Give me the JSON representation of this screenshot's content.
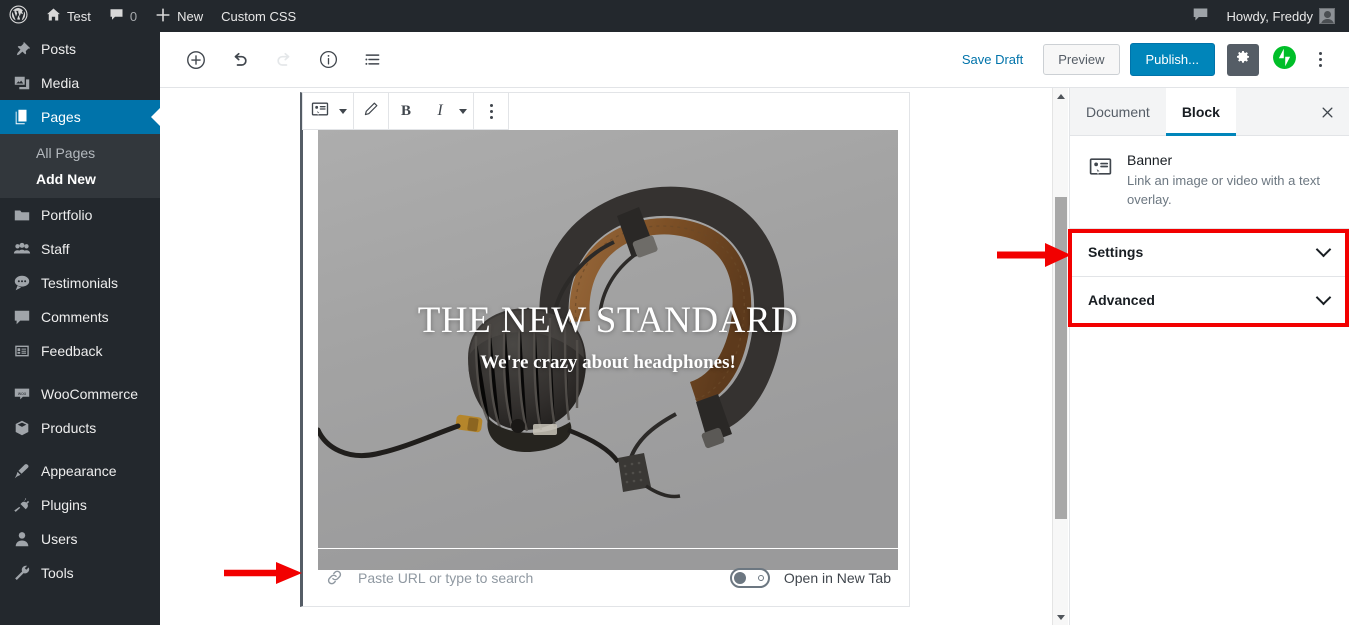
{
  "adminbar": {
    "logo_icon": "wordpress-logo-icon",
    "items": [
      {
        "icon": "home-icon",
        "label": "Test"
      },
      {
        "icon": "comment-icon",
        "label": "0"
      },
      {
        "icon": "plus-icon",
        "label": "New"
      },
      {
        "icon": "",
        "label": "Custom CSS"
      }
    ],
    "notifications_icon": "comment-bubble-icon",
    "howdy": "Howdy, Freddy",
    "avatar": "avatar"
  },
  "sidebar": {
    "items": [
      {
        "label": "Posts",
        "icon": "pin-icon",
        "current": false
      },
      {
        "label": "Media",
        "icon": "media-icon",
        "current": false
      },
      {
        "label": "Pages",
        "icon": "pages-icon",
        "current": true
      },
      {
        "label": "Portfolio",
        "icon": "portfolio-icon",
        "current": false
      },
      {
        "label": "Staff",
        "icon": "staff-icon",
        "current": false
      },
      {
        "label": "Testimonials",
        "icon": "testimonials-icon",
        "current": false
      },
      {
        "label": "Comments",
        "icon": "comments-icon",
        "current": false
      },
      {
        "label": "Feedback",
        "icon": "feedback-icon",
        "current": false
      },
      {
        "label": "WooCommerce",
        "icon": "woocommerce-icon",
        "current": false
      },
      {
        "label": "Products",
        "icon": "products-icon",
        "current": false
      },
      {
        "label": "Appearance",
        "icon": "appearance-icon",
        "current": false
      },
      {
        "label": "Plugins",
        "icon": "plugins-icon",
        "current": false
      },
      {
        "label": "Users",
        "icon": "users-icon",
        "current": false
      },
      {
        "label": "Tools",
        "icon": "tools-icon",
        "current": false
      }
    ],
    "submenu": [
      {
        "label": "All Pages",
        "current": false
      },
      {
        "label": "Add New",
        "current": true
      }
    ]
  },
  "editor_toolbar": {
    "add_block_icon": "plus-circle-icon",
    "undo_icon": "undo-icon",
    "redo_icon": "redo-icon",
    "info_icon": "info-circle-icon",
    "block_navigation_icon": "list-view-icon",
    "save_draft_label": "Save Draft",
    "preview_label": "Preview",
    "publish_label": "Publish...",
    "settings_gear_icon": "gear-icon",
    "jetpack_icon": "jetpack-icon",
    "more_menu_icon": "kebab-menu-icon"
  },
  "block_toolbar": {
    "block_type_icon": "banner-block-icon",
    "block_type_caret_icon": "chevron-down-icon",
    "edit_icon": "pencil-icon",
    "bold_label": "B",
    "italic_label": "I",
    "more_formats_caret_icon": "chevron-down-icon",
    "block_options_icon": "kebab-menu-icon"
  },
  "banner": {
    "heading": "THE NEW STANDARD",
    "subheading": "We're crazy about headphones!",
    "image_alt": "black and brown over-ear headphones on gray background",
    "background_color": "#a3a3a3"
  },
  "url_row": {
    "link_icon": "link-icon",
    "placeholder": "Paste URL or type to search",
    "value": "",
    "toggle_label": "Open in New Tab",
    "toggle_on": false
  },
  "inspector": {
    "tabs": [
      {
        "label": "Document",
        "active": false
      },
      {
        "label": "Block",
        "active": true
      }
    ],
    "close_icon": "close-icon",
    "block": {
      "icon": "banner-block-icon",
      "title": "Banner",
      "description": "Link an image or video with a text overlay."
    },
    "panels": [
      {
        "label": "Settings",
        "chevron": "chevron-down-icon"
      },
      {
        "label": "Advanced",
        "chevron": "chevron-down-icon"
      }
    ]
  },
  "scrollbar": {
    "up_arrow_icon": "scroll-up-arrow-icon",
    "down_arrow_icon": "scroll-down-arrow-icon"
  },
  "annotations": {
    "highlight_color": "#f20000",
    "arrow_to_panels": "red-arrow-pointing-to-settings-panels",
    "arrow_to_url": "red-arrow-pointing-to-url-field"
  }
}
